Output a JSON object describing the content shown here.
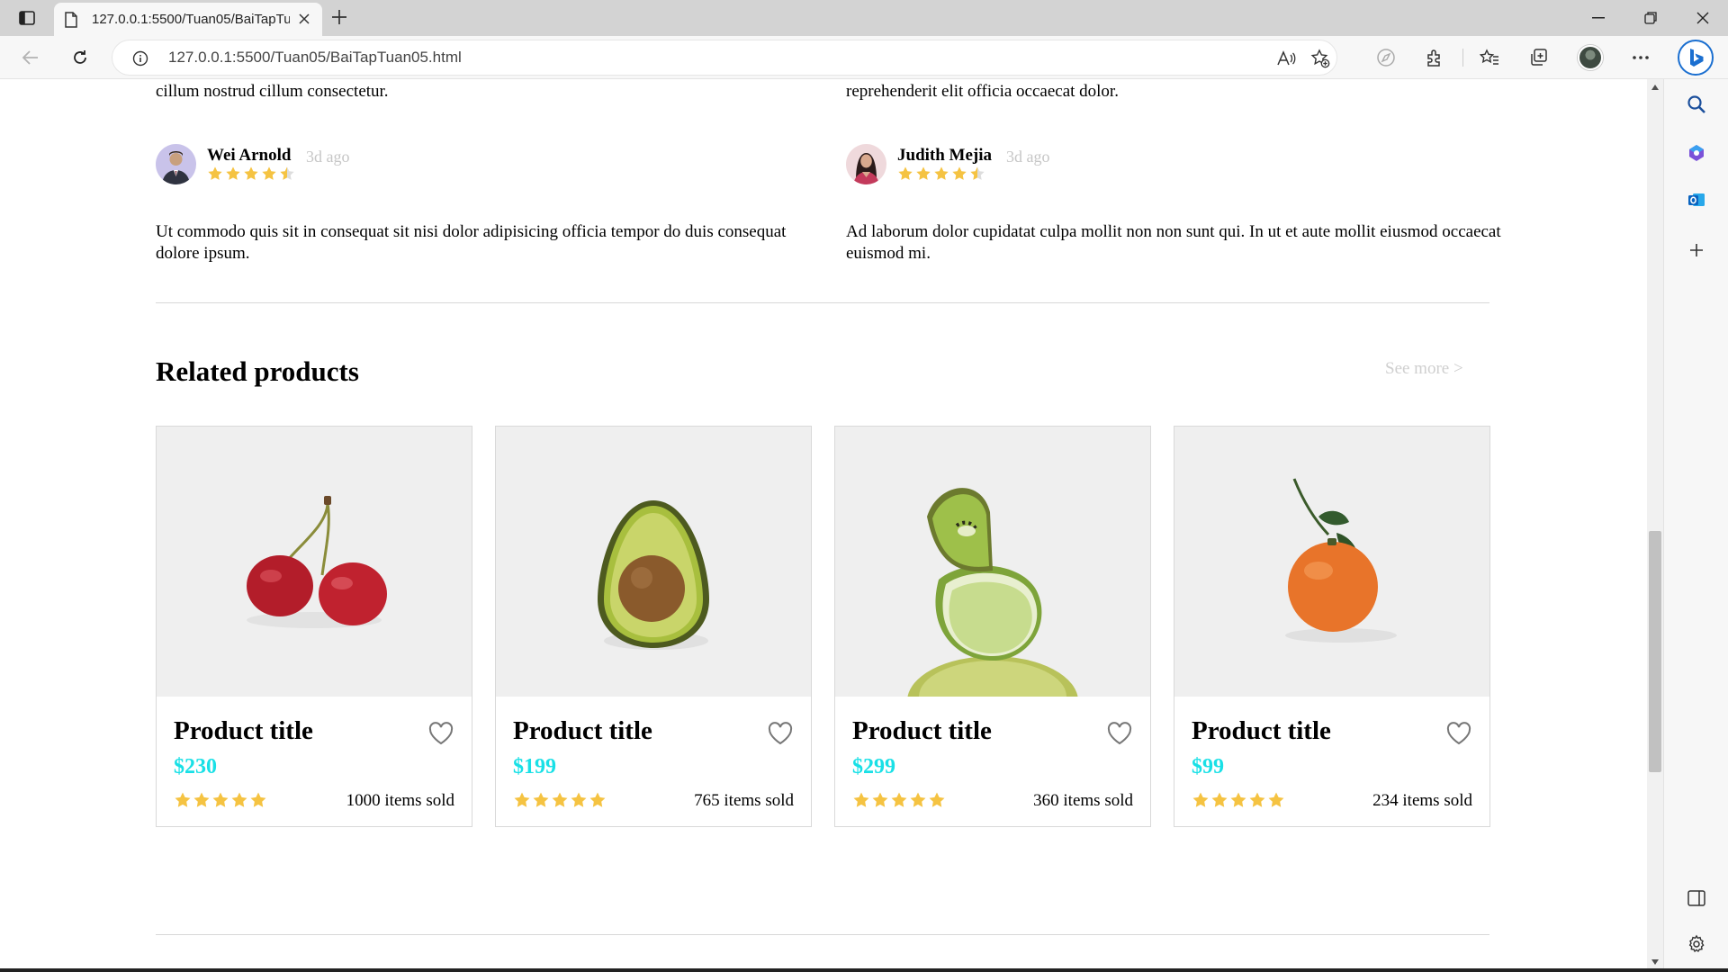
{
  "browser": {
    "tab_title": "127.0.0.1:5500/Tuan05/BaiTapTuan05.html",
    "url_host": "127.0.0.1",
    "url_rest": ":5500/Tuan05/BaiTapTuan05.html"
  },
  "reviews": {
    "left": {
      "previous_text": "cillum nostrud cillum consectetur.",
      "name": "Wei Arnold",
      "time": "3d ago",
      "rating": 4.5,
      "body": "Ut commodo quis sit in consequat sit nisi dolor adipisicing officia tempor do duis consequat dolore ipsum."
    },
    "right": {
      "previous_text": "reprehenderit elit officia occaecat dolor.",
      "name": "Judith Mejia",
      "time": "3d ago",
      "rating": 4.5,
      "body": "Ad laborum dolor cupidatat culpa mollit non non sunt qui. In ut et aute mollit eiusmod occaecat euismod mi."
    }
  },
  "related": {
    "title": "Related products",
    "see_more": "See more >",
    "products": [
      {
        "title": "Product title",
        "price": "$230",
        "rating": 5,
        "sold": "1000 items sold",
        "image": "cherry"
      },
      {
        "title": "Product title",
        "price": "$199",
        "rating": 5,
        "sold": "765 items sold",
        "image": "avocado"
      },
      {
        "title": "Product title",
        "price": "$299",
        "rating": 5,
        "sold": "360 items sold",
        "image": "kiwi-lime"
      },
      {
        "title": "Product title",
        "price": "$99",
        "rating": 5,
        "sold": "234 items sold",
        "image": "tangerine"
      }
    ]
  },
  "colors": {
    "price": "#19e0e6",
    "star": "#f5c342",
    "muted": "#c6c6c6"
  }
}
